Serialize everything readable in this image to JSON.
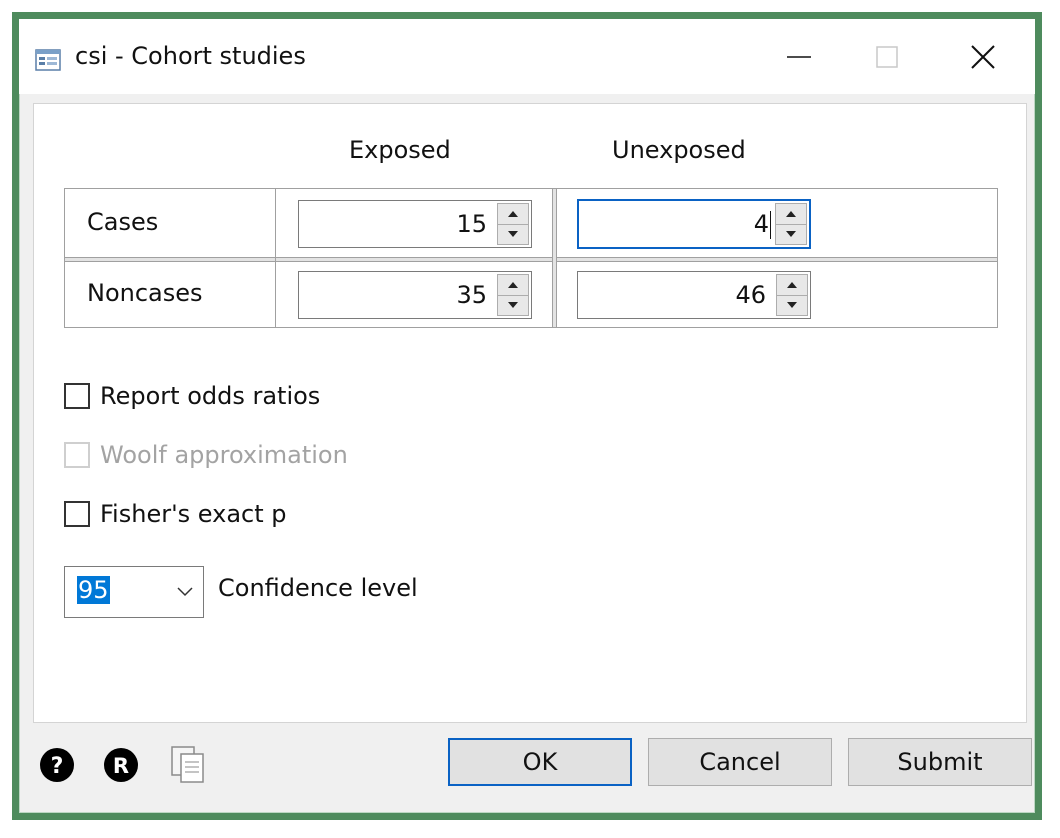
{
  "window": {
    "title": "csi - Cohort studies",
    "app_icon": "dialog-window-icon",
    "controls": [
      "minimize-icon",
      "maximize-icon",
      "close-icon"
    ]
  },
  "table": {
    "columns": [
      "Exposed",
      "Unexposed"
    ],
    "rows": [
      {
        "label": "Cases",
        "exposed": "15",
        "unexposed": "4"
      },
      {
        "label": "Noncases",
        "exposed": "35",
        "unexposed": "46"
      }
    ]
  },
  "options": {
    "report_odds_ratios": {
      "label": "Report odds ratios",
      "checked": false,
      "enabled": true
    },
    "woolf_approximation": {
      "label": "Woolf approximation",
      "checked": false,
      "enabled": false
    },
    "fishers_exact": {
      "label": "Fisher's exact p",
      "checked": false,
      "enabled": true
    }
  },
  "confidence": {
    "value": "95",
    "label": "Confidence level"
  },
  "footer": {
    "icons": [
      "help-icon",
      "r-icon",
      "copy-icon"
    ],
    "ok_label": "OK",
    "cancel_label": "Cancel",
    "submit_label": "Submit"
  },
  "colors": {
    "frame": "#4e8b5d",
    "focus": "#0a62c4",
    "selection": "#0078d7"
  }
}
